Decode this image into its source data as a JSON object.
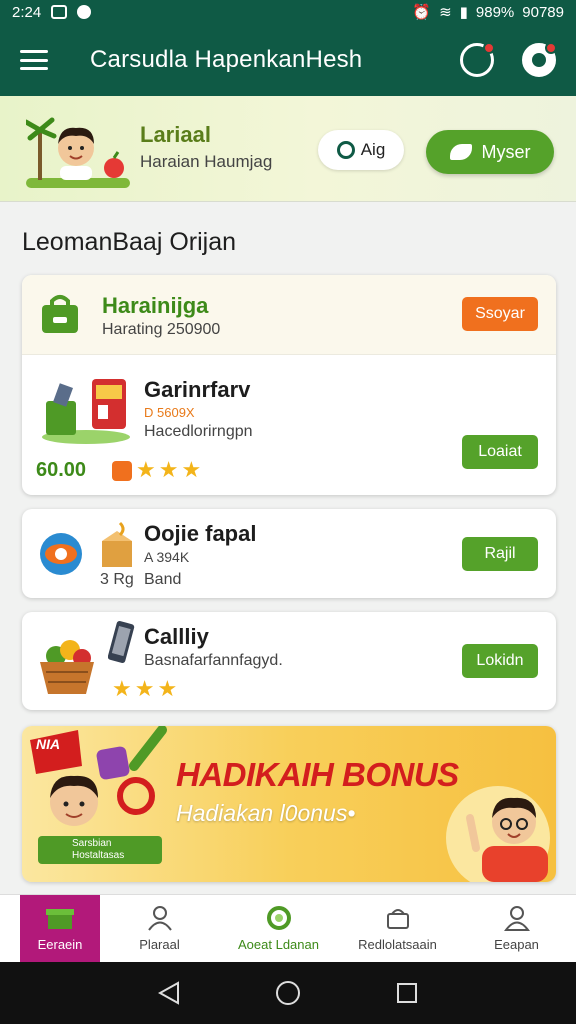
{
  "status_bar": {
    "time": "2:24",
    "battery": "989%",
    "extra": "90789"
  },
  "app_bar": {
    "title": "Carsudla HapenkanHesh"
  },
  "banner": {
    "name": "Lariaal",
    "subtitle": "Haraian Haumjag",
    "alg_button": "Aig",
    "myser_button": "Myser"
  },
  "section_title": "LeomanBaaj Orijan",
  "card1": {
    "header_title": "Harainijga",
    "header_sub": "Harating 250900",
    "header_button": "Ssoyar",
    "item_title": "Garinrfarv",
    "item_tag": "D 5609X",
    "item_sub": "Hacedlorirngpn",
    "price": "60.00",
    "stars": 3,
    "button": "Loaiat"
  },
  "card2": {
    "title": "Oojie fapal",
    "meta": "A 394K",
    "qty": "3 Rg",
    "qty_label": "Band",
    "button": "Rajil"
  },
  "card3": {
    "title": "Callliy",
    "sub": "Basnafarfannfagyd.",
    "stars": 3,
    "button": "Lokidn"
  },
  "promo": {
    "headline": "HADIKAIH BONUS",
    "subline": "Hadiakan l0onus•",
    "badge": "NIA",
    "tag_line1": "Sarsbian",
    "tag_line2": "Hostaltasas"
  },
  "bottom_nav": [
    {
      "label": "Eeraein"
    },
    {
      "label": "Plaraal"
    },
    {
      "label": "Aoeat Ldanan"
    },
    {
      "label": "Redlolatsaain"
    },
    {
      "label": "Eeapan"
    }
  ],
  "colors": {
    "primary": "#0f5a45",
    "accent_green": "#55a22a",
    "accent_orange": "#f0701e",
    "active_nav": "#b2197a",
    "promo_red": "#d31e1e"
  }
}
